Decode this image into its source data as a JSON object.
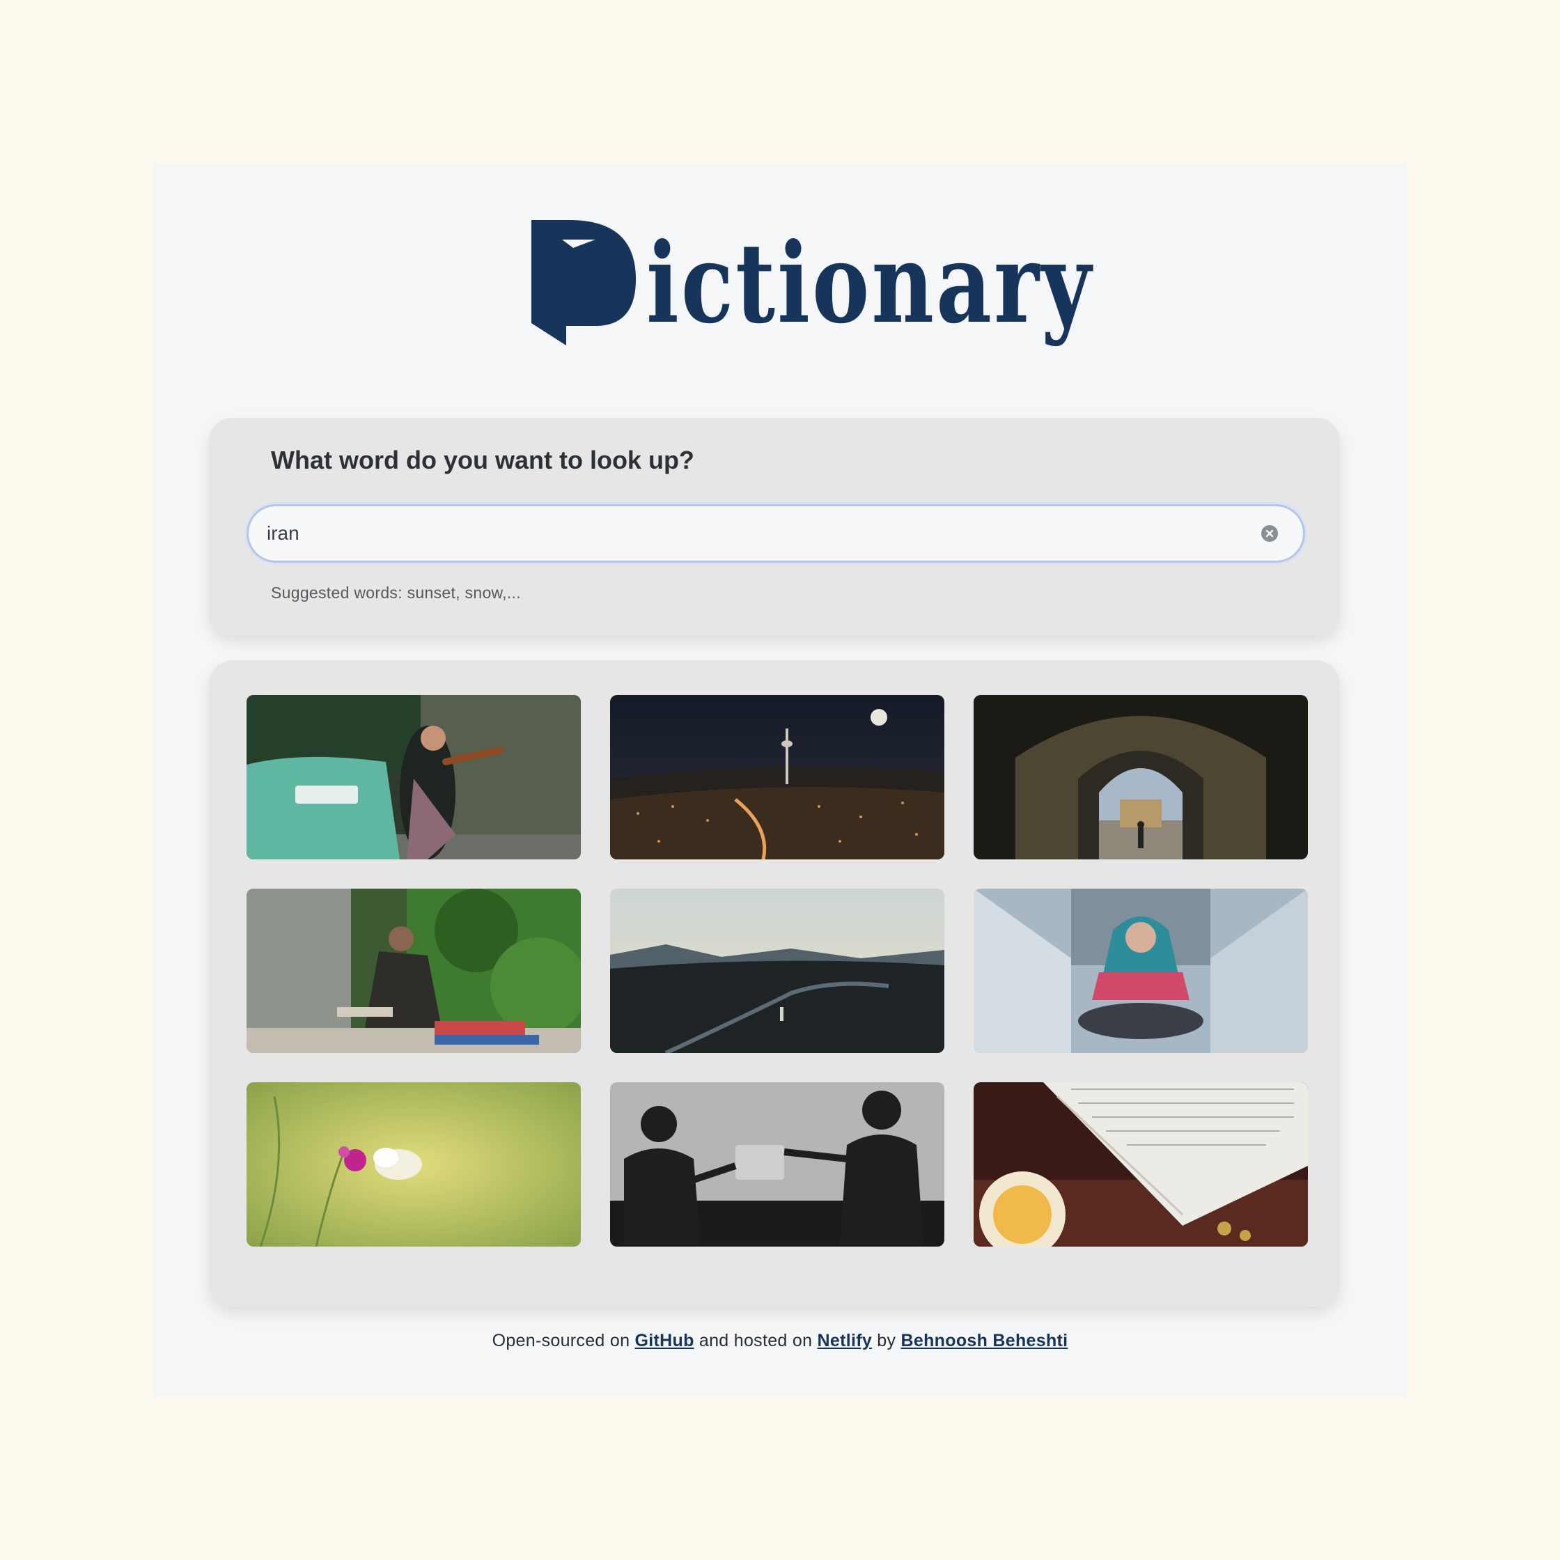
{
  "logo": {
    "text": "ictionary",
    "initial": "D"
  },
  "search": {
    "heading": "What word do you want to look up?",
    "value": "iran",
    "hint": "Suggested words: sunset, snow,..."
  },
  "gallery": {
    "photos": [
      "woman playing violin beside turquoise car",
      "city lights at night with tower and moon",
      "mosque archway courtyard",
      "elderly man sitting at street stall",
      "mountain valley with river at dusk",
      "woman in hoodie sitting on bridge",
      "pink flower with white butterfly",
      "silhouettes passing water bottles",
      "open book with sweets and coins on carpet"
    ]
  },
  "footer": {
    "part1": "Open-sourced on ",
    "github": "GitHub",
    "part2": " and hosted on ",
    "netlify": "Netlify",
    "part3": " by ",
    "author": "Behnoosh Beheshti"
  },
  "colors": {
    "accent": "#17345a",
    "page": "#fdf9ee",
    "panel": "#f5f6f7",
    "card": "#e6e6e7"
  }
}
